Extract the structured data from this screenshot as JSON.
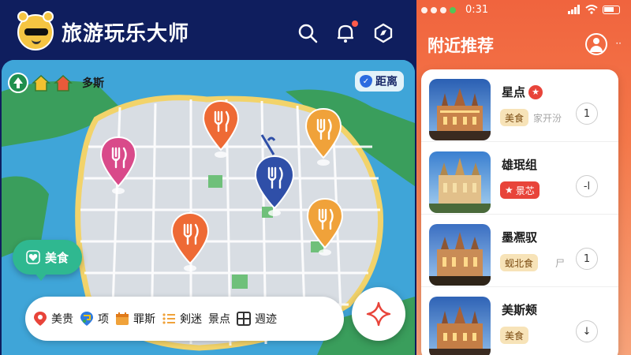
{
  "app": {
    "title": "旅游玩乐大师"
  },
  "header_icons": [
    "search-icon",
    "bell-icon",
    "compass-icon"
  ],
  "map": {
    "location_label": "多斯",
    "distance_button": "距离",
    "food_bubble": "美食",
    "categories": [
      {
        "label": "美贵",
        "icon": "pin-icon",
        "color": "#e8443a"
      },
      {
        "label": "项",
        "icon": "google-pin-icon",
        "color": "#2f7be0"
      },
      {
        "label": "罪斯",
        "icon": "calendar-icon",
        "color": "#f0a23a"
      },
      {
        "label": "剣迷",
        "icon": "list-icon",
        "color": "#f0a23a"
      },
      {
        "label": "景点",
        "icon": "",
        "color": ""
      },
      {
        "label": "週迹",
        "icon": "grid-icon",
        "color": "#333333"
      }
    ],
    "pins": [
      {
        "icon": "food-icon",
        "color": "#d94a8a"
      },
      {
        "icon": "food-icon",
        "color": "#ee6a35"
      },
      {
        "icon": "food-icon",
        "color": "#f0a23a"
      },
      {
        "icon": "food-icon",
        "color": "#2f4fa8"
      },
      {
        "icon": "food-icon",
        "color": "#ee6a35"
      },
      {
        "icon": "food-icon",
        "color": "#f0a23a"
      }
    ]
  },
  "status": {
    "time": "0:31"
  },
  "nearby": {
    "title": "附近推荐",
    "more": "··",
    "items": [
      {
        "title": "星点",
        "tag": "美食",
        "sub": "家开汾",
        "action": "1",
        "tag_style": "normal"
      },
      {
        "title": "雄珉组",
        "tag": "景芯",
        "sub": "",
        "action": "-l",
        "tag_style": "red"
      },
      {
        "title": "墨凞驭",
        "tag": "蚬北食",
        "sub": "尸",
        "action": "1",
        "tag_style": "normal"
      },
      {
        "title": "美斯颊",
        "tag": "美食",
        "sub": "",
        "action": "↓",
        "tag_style": "normal"
      }
    ]
  }
}
